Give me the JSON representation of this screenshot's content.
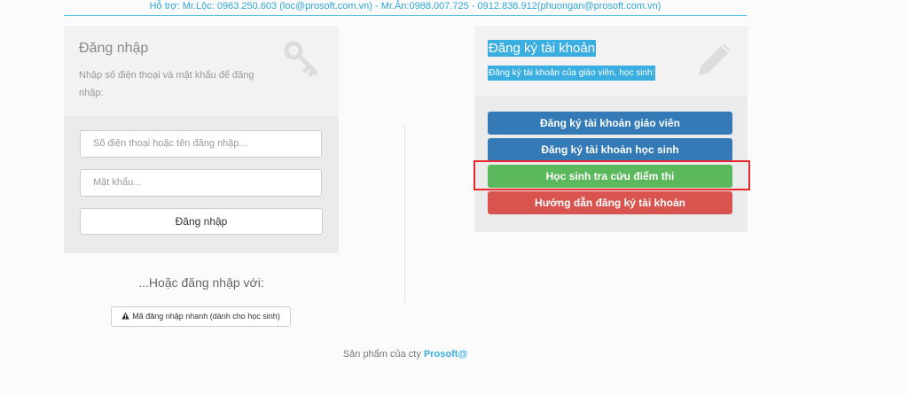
{
  "topbar": {
    "support_text": "Hỗ trợ: Mr.Lộc: 0963.250.603 (loc@prosoft.com.vn) - Mr.Ân:0988.007.725 - 0912.838.912(phuongan@prosoft.com.vn)"
  },
  "login": {
    "title": "Đăng nhập",
    "description": "Nhập số điện thoại và mật khẩu để đăng nhập:",
    "phone_placeholder": "Số điện thoại hoặc tên đăng nhập...",
    "password_placeholder": "Mật khẩu...",
    "submit_label": "Đăng nhập",
    "or_text": "...Hoặc đăng nhập với:",
    "quick_login_label": "Mã đăng nhập nhanh (dành cho học sinh)"
  },
  "register": {
    "title": "Đăng ký tài khoản",
    "description": "Đăng ký tài khoản của giáo viên, học sinh:",
    "buttons": [
      {
        "label": "Đăng ký tài khoản giáo viên",
        "color": "#337ab7"
      },
      {
        "label": "Đăng ký tài khoản học sinh",
        "color": "#337ab7"
      },
      {
        "label": "Học sinh tra cứu điểm thi",
        "color": "#5cb85c"
      },
      {
        "label": "Hướng dẫn đăng ký tài khoản",
        "color": "#d9534f"
      }
    ]
  },
  "footer": {
    "prefix": "Sản phẩm của cty",
    "brand": "Prosoft@"
  },
  "colors": {
    "accent": "#3aaee0",
    "highlight": "#e8262b"
  },
  "icons": {
    "login": "key-icon",
    "register": "pencil-icon",
    "quick_login": "warning-icon"
  }
}
